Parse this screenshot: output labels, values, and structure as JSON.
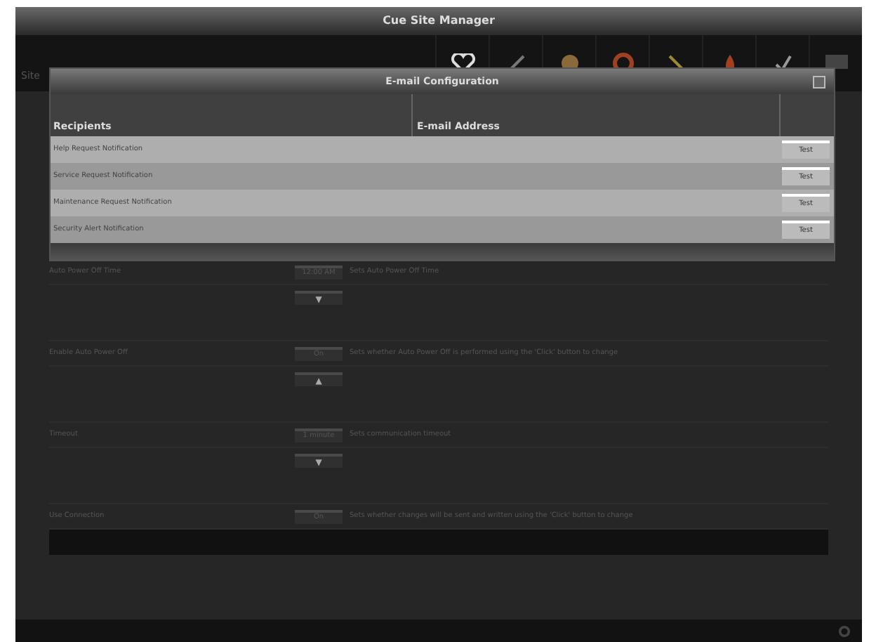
{
  "window": {
    "title": "Cue Site Manager",
    "tab": "Site"
  },
  "settings": [
    {
      "kind": "setting",
      "label": "Auto Power Off Time",
      "value": "12:00 AM",
      "description": "Sets Auto Power Off Time"
    },
    {
      "kind": "spinner",
      "arrow": "▼"
    },
    {
      "kind": "setting",
      "label": "Enable Auto Power Off",
      "value": "On",
      "description": "Sets whether Auto Power Off is performed using the 'Click' button to change"
    },
    {
      "kind": "spinner",
      "arrow": "▲"
    },
    {
      "kind": "setting",
      "label": "Timeout",
      "value": "1 minute",
      "description": "Sets communication timeout"
    },
    {
      "kind": "spinner",
      "arrow": "▼"
    },
    {
      "kind": "setting",
      "label": "Use Connection",
      "value": "On",
      "description": "Sets whether changes will be sent and written using the 'Click' button to change"
    }
  ],
  "dialog": {
    "title": "E-mail Configuration",
    "columns": [
      "Recipients",
      "E-mail Address"
    ],
    "rows": [
      {
        "recipient": "Help Request Notification",
        "button": "Test"
      },
      {
        "recipient": "Service Request Notification",
        "button": "Test"
      },
      {
        "recipient": "Maintenance Request Notification",
        "button": "Test"
      },
      {
        "recipient": "Security Alert Notification",
        "button": "Test"
      }
    ]
  }
}
